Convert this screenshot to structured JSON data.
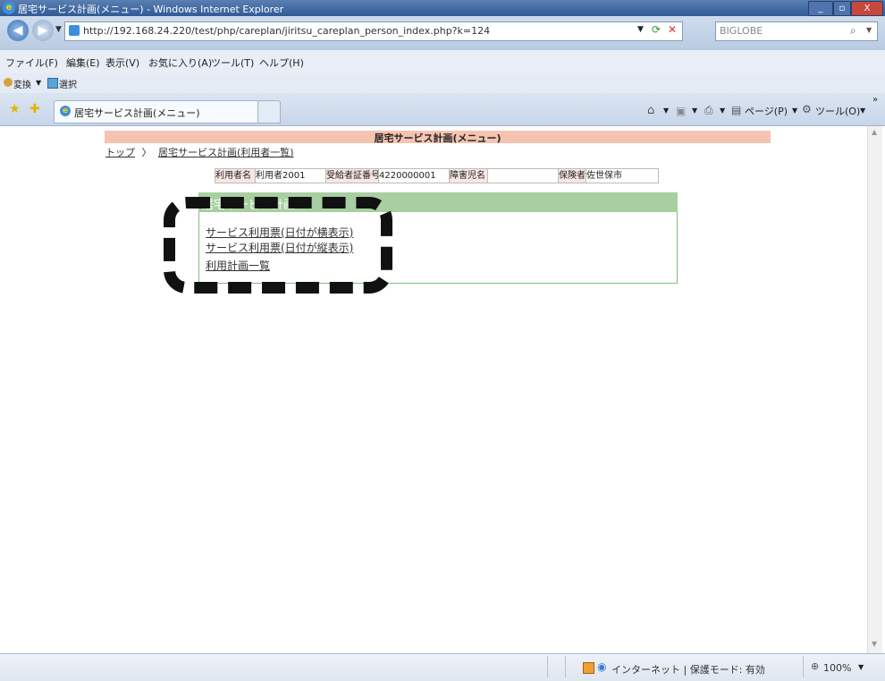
{
  "window": {
    "title": "居宅サービス計画(メニュー) - Windows Internet Explorer",
    "buttons": {
      "minimize": "_",
      "restore": "▫",
      "close": "X"
    }
  },
  "address_bar": {
    "url": "http://192.168.24.220/test/php/careplan/jiritsu_careplan_person_index.php?k=124",
    "search_provider": "BIGLOBE"
  },
  "menu": {
    "items": [
      "ファイル(F)",
      "編集(E)",
      "表示(V)",
      "お気に入り(A)",
      "ツール(T)",
      "ヘルプ(H)"
    ]
  },
  "toolbar": {
    "convert_label": "変換",
    "select_label": "選択",
    "page_label": "ページ(P)",
    "tools_label": "ツール(O)"
  },
  "tab": {
    "label": "居宅サービス計画(メニュー)"
  },
  "page": {
    "heading": "居宅サービス計画(メニュー)",
    "breadcrumb": {
      "top": "トップ",
      "separator": "〉",
      "current": "居宅サービス計画(利用者一覧)"
    }
  },
  "user_info": {
    "name_label": "利用者名",
    "name_value": "利用者2001",
    "cert_label": "受給者証番号",
    "cert_value": "4220000001",
    "child_label": "障害児名",
    "child_value": "",
    "insurer_label": "保険者",
    "insurer_value": "佐世保市"
  },
  "menu_box": {
    "title": "居宅サービス計画",
    "links": [
      "サービス利用票(日付が横表示)",
      "サービス利用票(日付が縦表示)",
      "利用計画一覧"
    ]
  },
  "status_bar": {
    "zone": "インターネット | 保護モード: 有効",
    "zoom": "100%"
  }
}
